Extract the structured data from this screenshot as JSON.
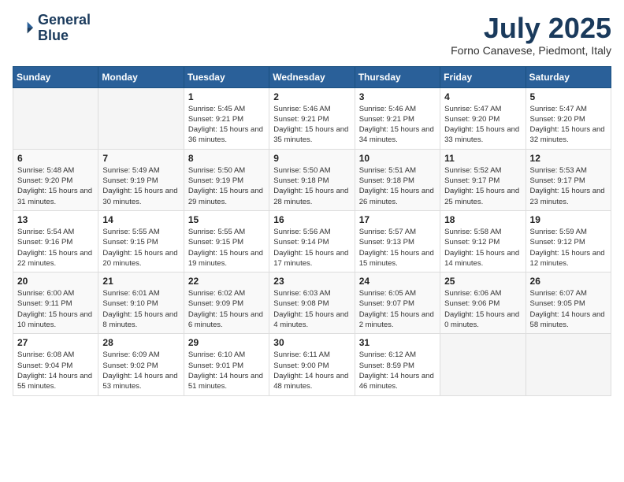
{
  "header": {
    "logo_line1": "General",
    "logo_line2": "Blue",
    "month": "July 2025",
    "location": "Forno Canavese, Piedmont, Italy"
  },
  "weekdays": [
    "Sunday",
    "Monday",
    "Tuesday",
    "Wednesday",
    "Thursday",
    "Friday",
    "Saturday"
  ],
  "weeks": [
    [
      {
        "day": "",
        "content": ""
      },
      {
        "day": "",
        "content": ""
      },
      {
        "day": "1",
        "content": "Sunrise: 5:45 AM\nSunset: 9:21 PM\nDaylight: 15 hours and 36 minutes."
      },
      {
        "day": "2",
        "content": "Sunrise: 5:46 AM\nSunset: 9:21 PM\nDaylight: 15 hours and 35 minutes."
      },
      {
        "day": "3",
        "content": "Sunrise: 5:46 AM\nSunset: 9:21 PM\nDaylight: 15 hours and 34 minutes."
      },
      {
        "day": "4",
        "content": "Sunrise: 5:47 AM\nSunset: 9:20 PM\nDaylight: 15 hours and 33 minutes."
      },
      {
        "day": "5",
        "content": "Sunrise: 5:47 AM\nSunset: 9:20 PM\nDaylight: 15 hours and 32 minutes."
      }
    ],
    [
      {
        "day": "6",
        "content": "Sunrise: 5:48 AM\nSunset: 9:20 PM\nDaylight: 15 hours and 31 minutes."
      },
      {
        "day": "7",
        "content": "Sunrise: 5:49 AM\nSunset: 9:19 PM\nDaylight: 15 hours and 30 minutes."
      },
      {
        "day": "8",
        "content": "Sunrise: 5:50 AM\nSunset: 9:19 PM\nDaylight: 15 hours and 29 minutes."
      },
      {
        "day": "9",
        "content": "Sunrise: 5:50 AM\nSunset: 9:18 PM\nDaylight: 15 hours and 28 minutes."
      },
      {
        "day": "10",
        "content": "Sunrise: 5:51 AM\nSunset: 9:18 PM\nDaylight: 15 hours and 26 minutes."
      },
      {
        "day": "11",
        "content": "Sunrise: 5:52 AM\nSunset: 9:17 PM\nDaylight: 15 hours and 25 minutes."
      },
      {
        "day": "12",
        "content": "Sunrise: 5:53 AM\nSunset: 9:17 PM\nDaylight: 15 hours and 23 minutes."
      }
    ],
    [
      {
        "day": "13",
        "content": "Sunrise: 5:54 AM\nSunset: 9:16 PM\nDaylight: 15 hours and 22 minutes."
      },
      {
        "day": "14",
        "content": "Sunrise: 5:55 AM\nSunset: 9:15 PM\nDaylight: 15 hours and 20 minutes."
      },
      {
        "day": "15",
        "content": "Sunrise: 5:55 AM\nSunset: 9:15 PM\nDaylight: 15 hours and 19 minutes."
      },
      {
        "day": "16",
        "content": "Sunrise: 5:56 AM\nSunset: 9:14 PM\nDaylight: 15 hours and 17 minutes."
      },
      {
        "day": "17",
        "content": "Sunrise: 5:57 AM\nSunset: 9:13 PM\nDaylight: 15 hours and 15 minutes."
      },
      {
        "day": "18",
        "content": "Sunrise: 5:58 AM\nSunset: 9:12 PM\nDaylight: 15 hours and 14 minutes."
      },
      {
        "day": "19",
        "content": "Sunrise: 5:59 AM\nSunset: 9:12 PM\nDaylight: 15 hours and 12 minutes."
      }
    ],
    [
      {
        "day": "20",
        "content": "Sunrise: 6:00 AM\nSunset: 9:11 PM\nDaylight: 15 hours and 10 minutes."
      },
      {
        "day": "21",
        "content": "Sunrise: 6:01 AM\nSunset: 9:10 PM\nDaylight: 15 hours and 8 minutes."
      },
      {
        "day": "22",
        "content": "Sunrise: 6:02 AM\nSunset: 9:09 PM\nDaylight: 15 hours and 6 minutes."
      },
      {
        "day": "23",
        "content": "Sunrise: 6:03 AM\nSunset: 9:08 PM\nDaylight: 15 hours and 4 minutes."
      },
      {
        "day": "24",
        "content": "Sunrise: 6:05 AM\nSunset: 9:07 PM\nDaylight: 15 hours and 2 minutes."
      },
      {
        "day": "25",
        "content": "Sunrise: 6:06 AM\nSunset: 9:06 PM\nDaylight: 15 hours and 0 minutes."
      },
      {
        "day": "26",
        "content": "Sunrise: 6:07 AM\nSunset: 9:05 PM\nDaylight: 14 hours and 58 minutes."
      }
    ],
    [
      {
        "day": "27",
        "content": "Sunrise: 6:08 AM\nSunset: 9:04 PM\nDaylight: 14 hours and 55 minutes."
      },
      {
        "day": "28",
        "content": "Sunrise: 6:09 AM\nSunset: 9:02 PM\nDaylight: 14 hours and 53 minutes."
      },
      {
        "day": "29",
        "content": "Sunrise: 6:10 AM\nSunset: 9:01 PM\nDaylight: 14 hours and 51 minutes."
      },
      {
        "day": "30",
        "content": "Sunrise: 6:11 AM\nSunset: 9:00 PM\nDaylight: 14 hours and 48 minutes."
      },
      {
        "day": "31",
        "content": "Sunrise: 6:12 AM\nSunset: 8:59 PM\nDaylight: 14 hours and 46 minutes."
      },
      {
        "day": "",
        "content": ""
      },
      {
        "day": "",
        "content": ""
      }
    ]
  ]
}
